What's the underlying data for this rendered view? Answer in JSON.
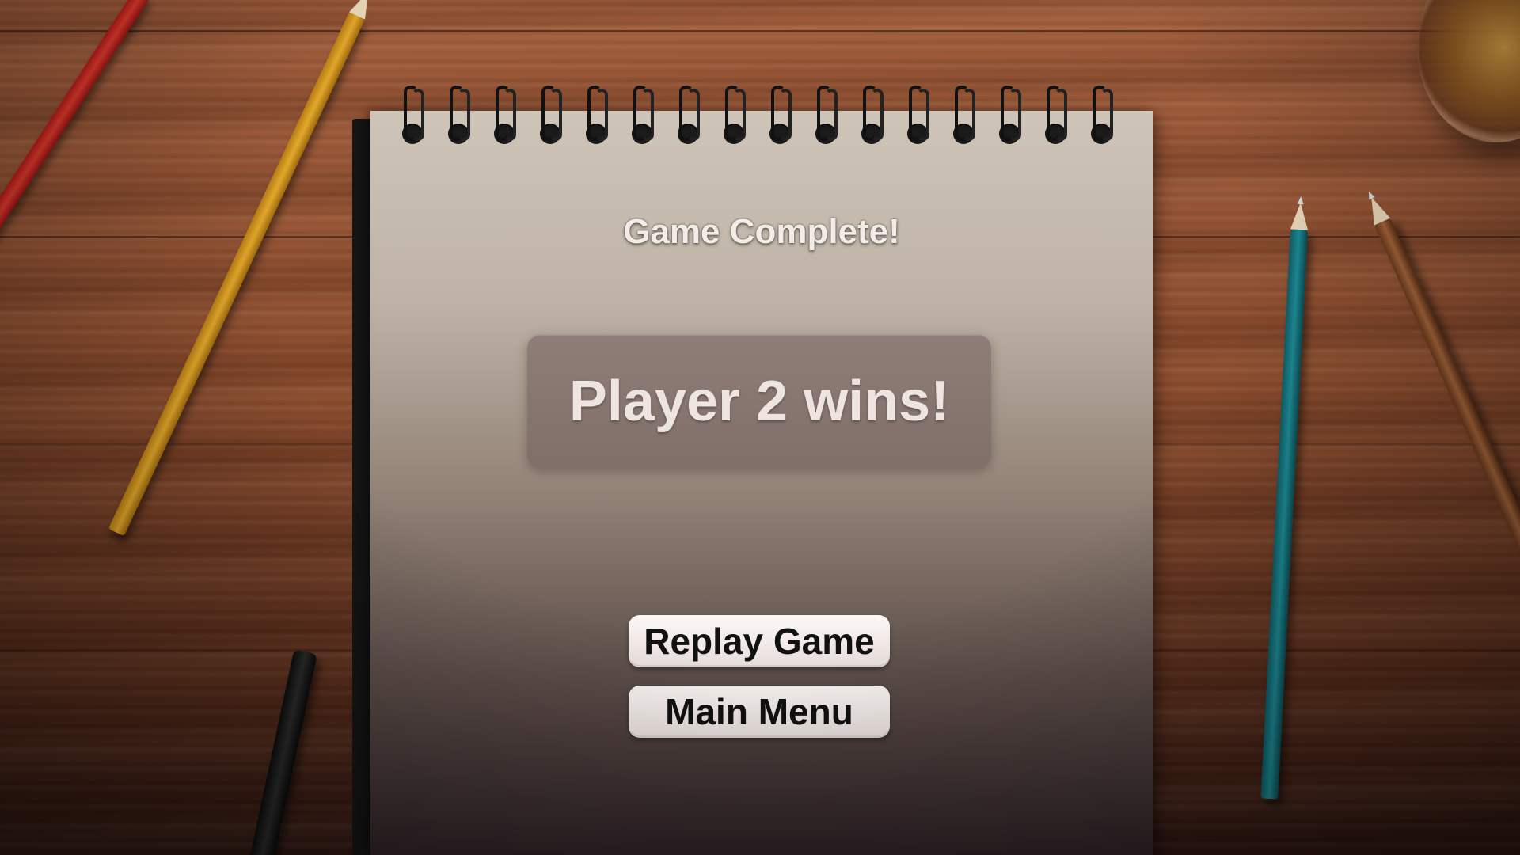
{
  "screen": {
    "title": "Game Complete!",
    "result": "Player 2 wins!"
  },
  "buttons": {
    "replay_label": "Replay Game",
    "menu_label": "Main Menu"
  },
  "colors": {
    "button_bg": "#f4eeec",
    "button_text": "#111111",
    "title_text": "#f4ece6",
    "result_text": "#eee4e0"
  },
  "icons": {
    "notebook_rings": "spiral-binding"
  }
}
